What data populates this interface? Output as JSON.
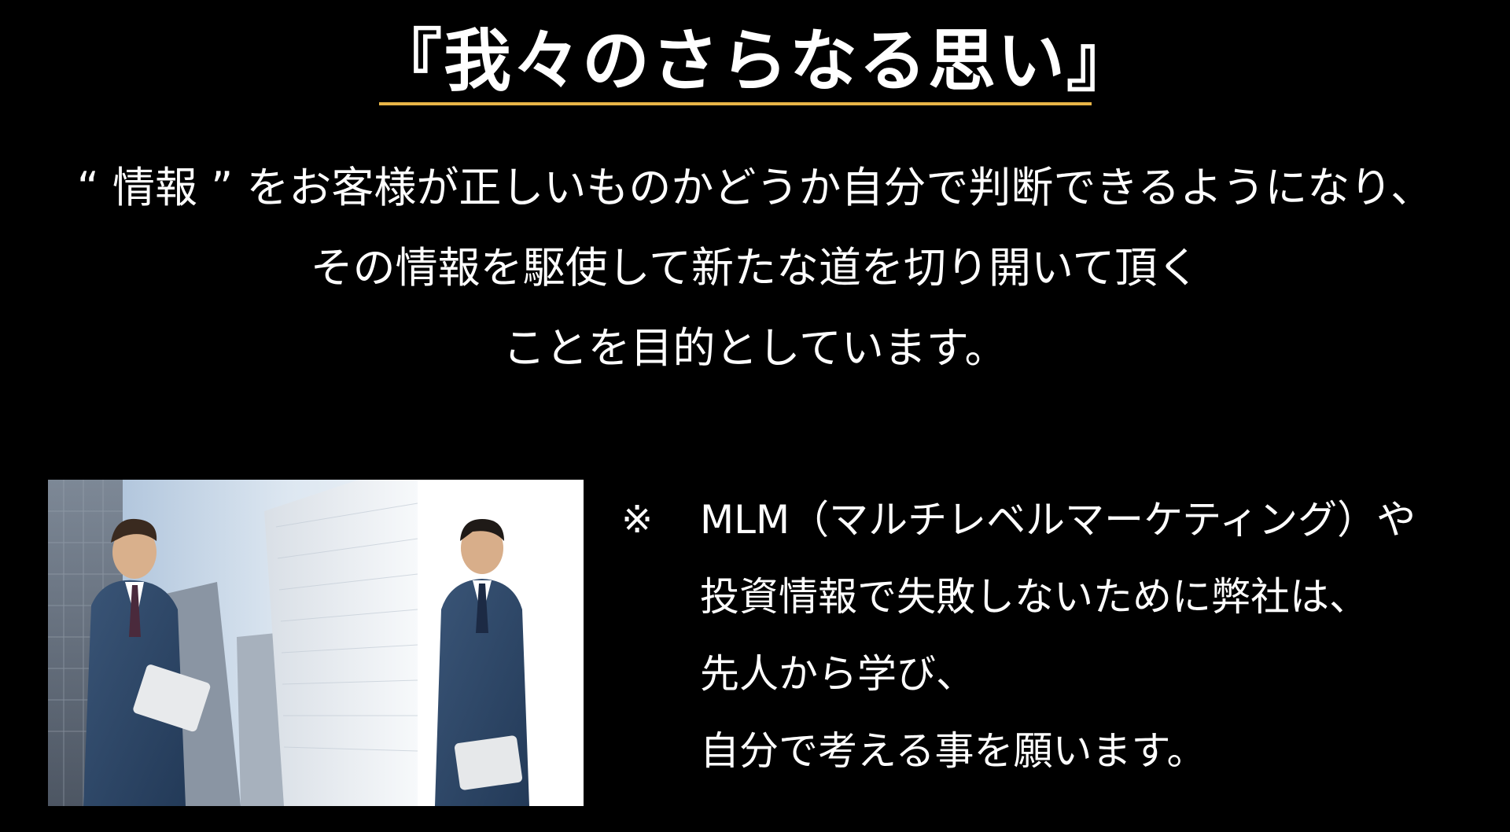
{
  "title": "『我々のさらなる思い』",
  "intro": {
    "lines": [
      "“ 情報 ” をお客様が正しいものかどうか自分で判断できるようになり、",
      "その情報を駆使して新たな道を切り開いて頂く",
      "ことを目的としています。"
    ]
  },
  "note": {
    "mark": "※",
    "lines": [
      "MLM（マルチレベルマーケティング）や",
      "投資情報で失敗しないために弊社は、",
      "先人から学び、",
      "自分で考える事を願います。"
    ]
  },
  "colors": {
    "background": "#000000",
    "text": "#ffffff",
    "accent_underline": "#e8b547"
  },
  "photo": {
    "subject": "two-businessmen-with-office-buildings"
  }
}
